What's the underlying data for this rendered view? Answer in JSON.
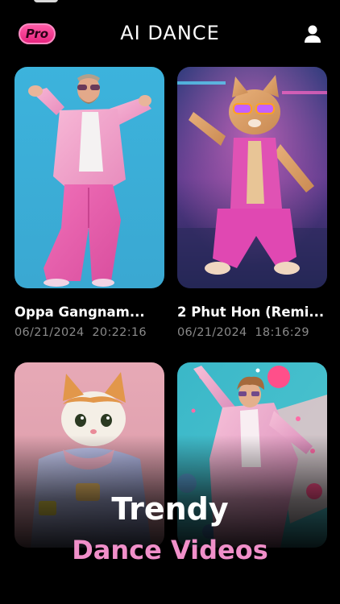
{
  "header": {
    "pro_label": "Pro",
    "title": "AI DANCE",
    "profile_icon": "user-icon"
  },
  "videos": [
    {
      "title": "Oppa Gangnam...",
      "date": "06/21/2024",
      "time": "20:22:16"
    },
    {
      "title": "2 Phut Hon (Remi...",
      "date": "06/21/2024",
      "time": "18:16:29"
    },
    {
      "title": "",
      "date": "",
      "time": ""
    },
    {
      "title": "",
      "date": "",
      "time": ""
    }
  ],
  "promo": {
    "line1": "Trendy",
    "line2": "Dance Videos"
  },
  "colors": {
    "background": "#000000",
    "pro_badge": "#ff4fa0",
    "promo_accent": "#f08fc9",
    "meta_text": "#8a8a8a"
  }
}
